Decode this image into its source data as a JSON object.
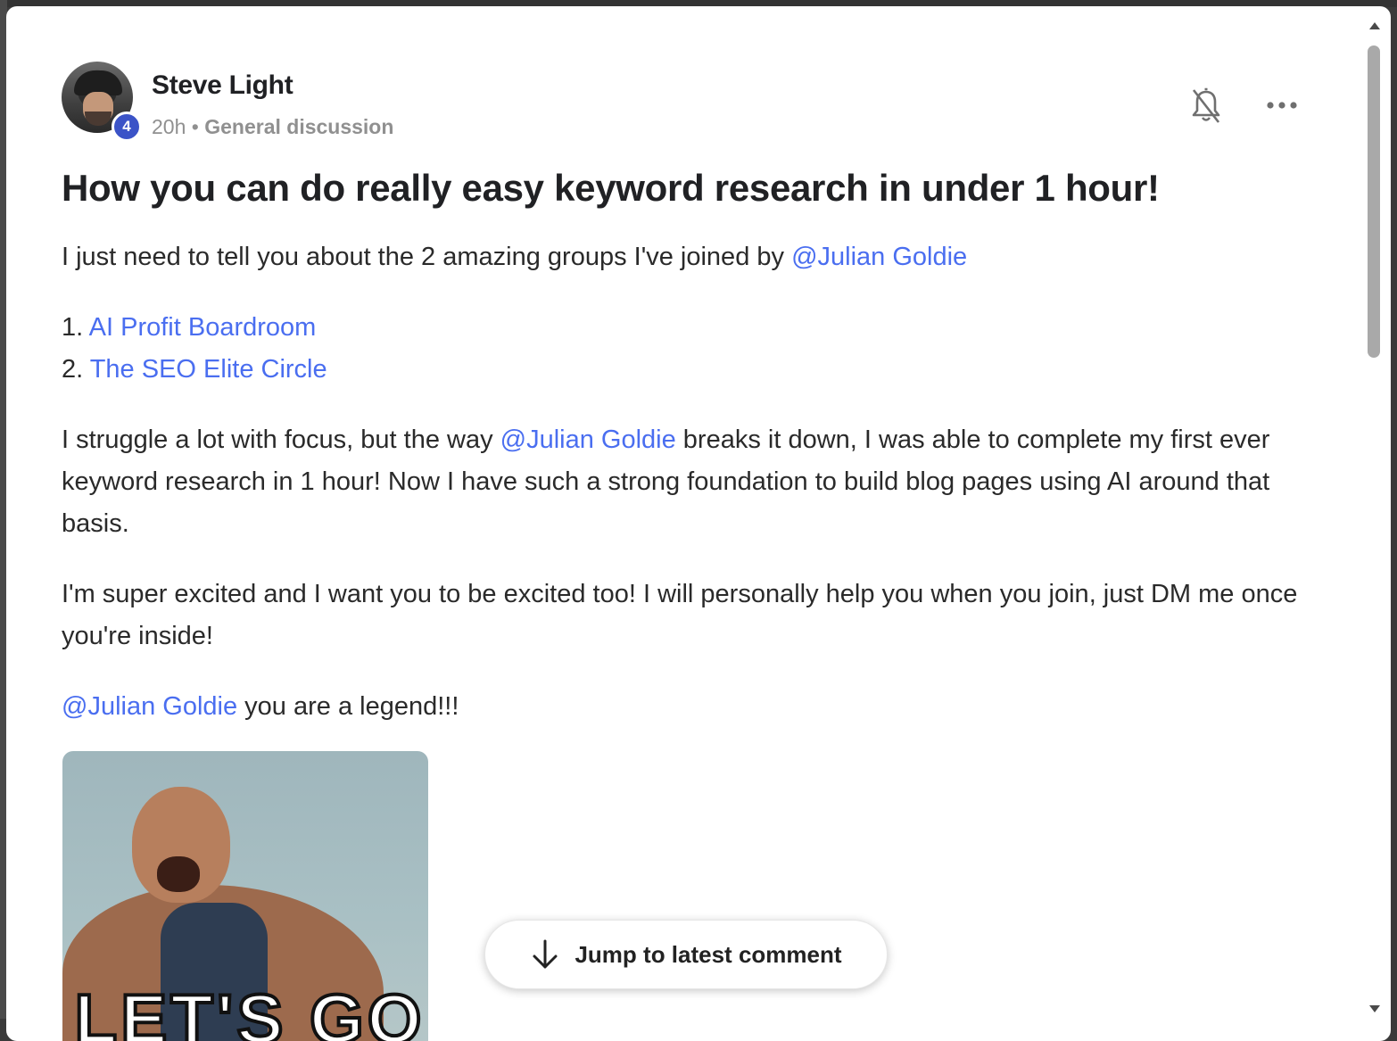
{
  "post": {
    "author": "Steve Light",
    "level": "4",
    "time": "20h",
    "separator": " • ",
    "category": "General discussion",
    "title": "How you can do really easy keyword research in under 1 hour!",
    "intro_text": "I just need to tell you about the 2 amazing groups I've joined by ",
    "mention": "@Julian Goldie",
    "list": [
      {
        "number": "1. ",
        "label": "AI Profit Boardroom"
      },
      {
        "number": "2. ",
        "label": "The SEO Elite Circle"
      }
    ],
    "para2_before": "I struggle a lot with focus, but the way ",
    "para2_after": " breaks it down, I was able to complete my first ever keyword research in 1 hour! Now I have such a strong foundation to build blog pages using AI around that basis.",
    "para3": "I'm super excited and I want you to be excited too! I will personally help you when you join, just DM me once you're inside!",
    "para4_after": " you are a legend!!!",
    "gif_caption": "LET'S GO"
  },
  "actions": {
    "bell_icon": "bell-off-icon",
    "more_icon": "more-horizontal-icon",
    "jump_label": "Jump to latest comment",
    "jump_icon": "arrow-down-icon"
  },
  "colors": {
    "mention": "#4a6ef0",
    "badge": "#3b53c7"
  }
}
